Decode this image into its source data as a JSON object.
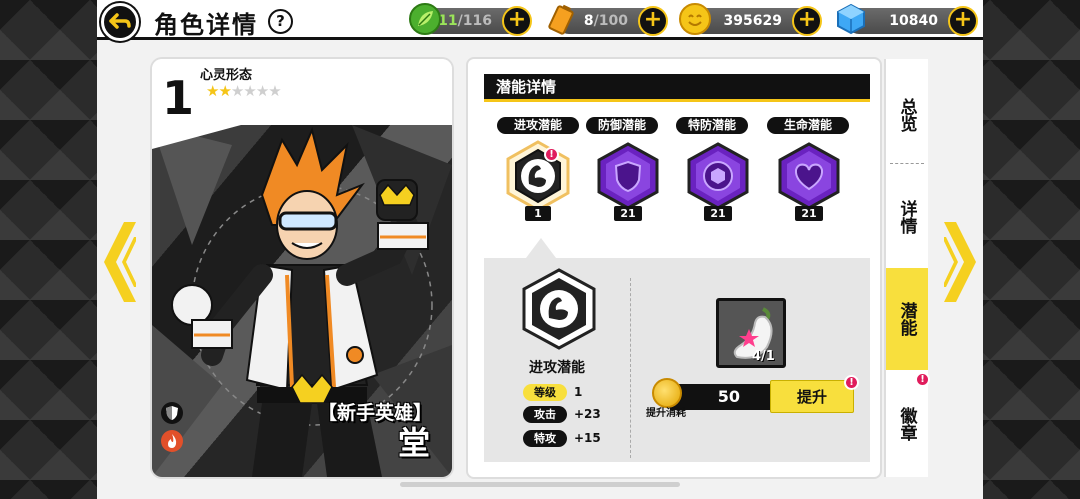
{
  "header": {
    "title": "角色详情",
    "help_label": "?",
    "back_label": "↩"
  },
  "resources": {
    "energy": {
      "current": "11",
      "max": "/116"
    },
    "stamina": {
      "current": "8",
      "max": "/100"
    },
    "coins": "395629",
    "gems": "10840",
    "plus": "+"
  },
  "card": {
    "rank": "1",
    "form_label": "心灵形态",
    "stars_filled": 2,
    "stars_total": 6,
    "hero_title": "【新手英雄】",
    "hero_name": "堂"
  },
  "panel": {
    "title": "潜能详情",
    "potentials": [
      {
        "label": "进攻潜能",
        "level": "1",
        "icon": "muscle-icon",
        "alert": true,
        "selected": true
      },
      {
        "label": "防御潜能",
        "level": "21",
        "icon": "shield-icon",
        "alert": false,
        "selected": false
      },
      {
        "label": "特防潜能",
        "level": "21",
        "icon": "hexball-icon",
        "alert": false,
        "selected": false
      },
      {
        "label": "生命潜能",
        "level": "21",
        "icon": "heart-icon",
        "alert": false,
        "selected": false
      }
    ],
    "selected": {
      "name": "进攻潜能",
      "stats": [
        {
          "label": "等级",
          "value": "1"
        },
        {
          "label": "攻击",
          "value": "+23"
        },
        {
          "label": "特攻",
          "value": "+15"
        }
      ]
    },
    "item": {
      "count": "4/1"
    },
    "cost": {
      "value": "50",
      "label": "提升消耗"
    },
    "upgrade_label": "提升"
  },
  "side_tabs": [
    {
      "label": "总览",
      "active": false
    },
    {
      "label": "详情",
      "active": false
    },
    {
      "label": "潜能",
      "active": true
    },
    {
      "label": "徽章",
      "active": false
    }
  ],
  "colors": {
    "accent": "#f8df3d",
    "alert": "#e01c5c",
    "potential_purple": "#7a2fd0"
  }
}
